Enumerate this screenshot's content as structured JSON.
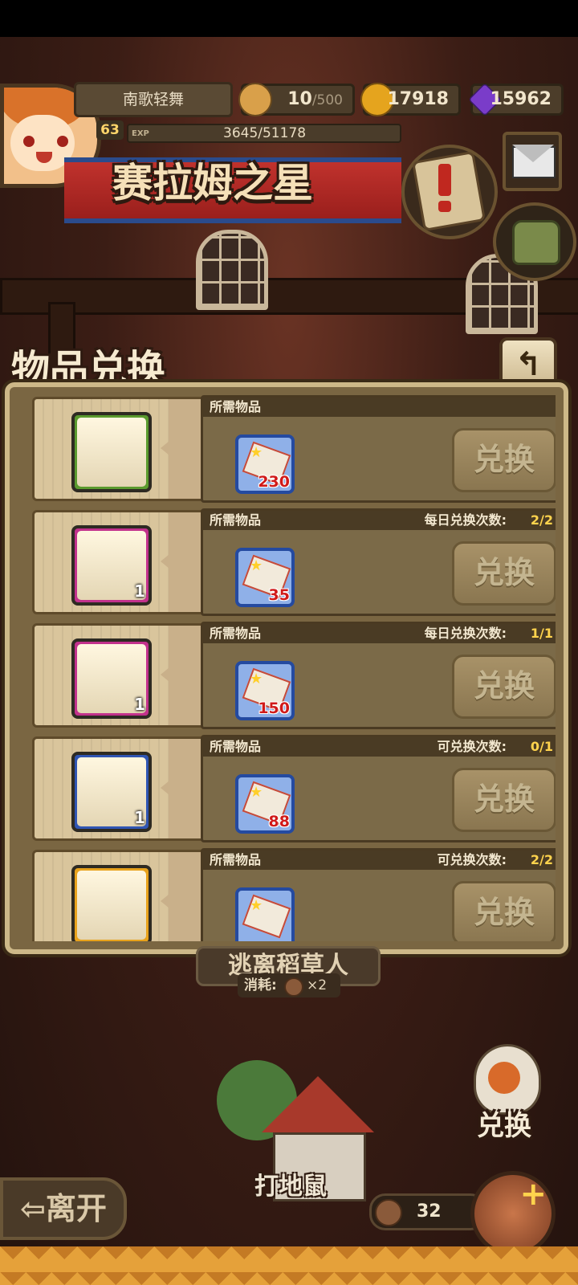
{
  "hud": {
    "player_name": "南歌轻舞",
    "level": "63",
    "exp_label": "EXP",
    "exp": "3645/51178",
    "stamina_current": "10",
    "stamina_max": "/500",
    "gold": "17918",
    "gems": "15962"
  },
  "banner_title": "赛拉姆之星",
  "panel": {
    "title": "物品兑换",
    "back_icon": "↰",
    "rows": [
      {
        "item_color": "#5a9a2e",
        "item_qty": "",
        "req_label": "所需物品",
        "limit_label": "",
        "limit_count": "",
        "ticket_cost": "230",
        "button": "兑换"
      },
      {
        "item_color": "#c2318c",
        "item_qty": "1",
        "req_label": "所需物品",
        "limit_label": "每日兑换次数:",
        "limit_count": "2/2",
        "ticket_cost": "35",
        "button": "兑换"
      },
      {
        "item_color": "#c2318c",
        "item_qty": "1",
        "req_label": "所需物品",
        "limit_label": "每日兑换次数:",
        "limit_count": "1/1",
        "ticket_cost": "150",
        "button": "兑换"
      },
      {
        "item_color": "#2f55b3",
        "item_qty": "1",
        "req_label": "所需物品",
        "limit_label": "可兑换次数:",
        "limit_count": "0/1",
        "ticket_cost": "88",
        "button": "兑换"
      },
      {
        "item_color": "#e8a21c",
        "item_qty": "",
        "req_label": "所需物品",
        "limit_label": "可兑换次数:",
        "limit_count": "2/2",
        "ticket_cost": "",
        "button": "兑换"
      }
    ]
  },
  "scene": {
    "game_label": "逃离稻草人",
    "consume_label": "消耗:",
    "consume_value": "×2",
    "game_name": "打地鼠",
    "exchange_side_label": "兑换",
    "leave_label": "⇦离开",
    "coin_count": "32"
  },
  "colors": {
    "accent_gold": "#ffd34d",
    "panel_bg": "#7a6642",
    "ticket_cost": "#d01a1a"
  }
}
